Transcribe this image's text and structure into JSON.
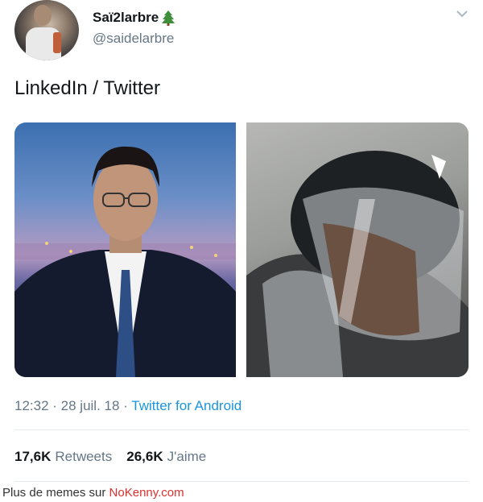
{
  "user": {
    "display_name": "Saï2larbre",
    "emoji_icon": "evergreen-tree-icon",
    "handle": "@saidelarbre"
  },
  "tweet": {
    "text": "LinkedIn / Twitter",
    "time": "12:32",
    "separator1": " · ",
    "date": "28 juil. 18",
    "separator2": " · ",
    "source": "Twitter for Android"
  },
  "stats": {
    "retweets_count": "17,6K",
    "retweets_label": "Retweets",
    "likes_count": "26,6K",
    "likes_label": "J'aime"
  },
  "footer": {
    "prefix": "Plus de memes sur ",
    "brand": "NoKenny.com"
  },
  "colors": {
    "link": "#1b95e0",
    "muted": "#657786",
    "brand": "#e0302d"
  }
}
